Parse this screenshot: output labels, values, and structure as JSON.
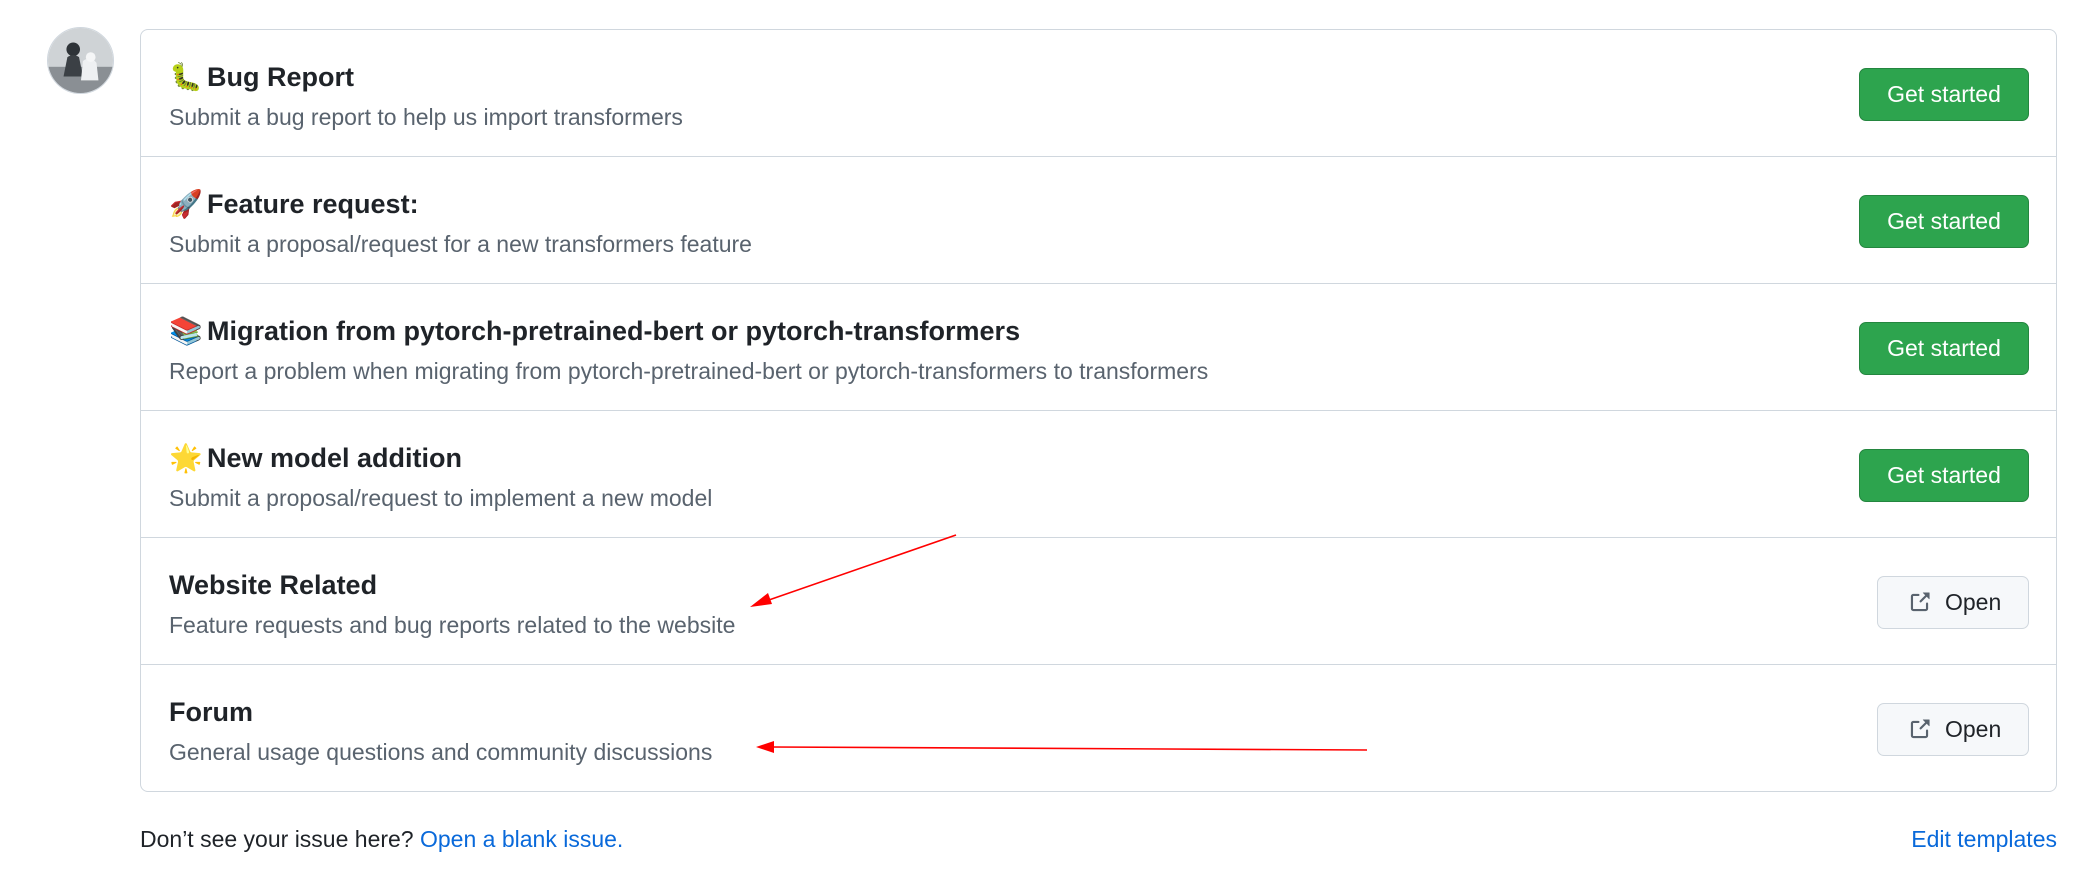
{
  "templates": [
    {
      "emoji": "🐛",
      "title": "Bug Report",
      "description": "Submit a bug report to help us import transformers",
      "action": "Get started"
    },
    {
      "emoji": "🚀",
      "title": "Feature request:",
      "description": "Submit a proposal/request for a new transformers feature",
      "action": "Get started"
    },
    {
      "emoji": "📚",
      "title": "Migration from pytorch-pretrained-bert or pytorch-transformers",
      "description": "Report a problem when migrating from pytorch-pretrained-bert or pytorch-transformers to transformers",
      "action": "Get started"
    },
    {
      "emoji": "🌟",
      "title": "New model addition",
      "description": "Submit a proposal/request to implement a new model",
      "action": "Get started"
    }
  ],
  "links": [
    {
      "title": "Website Related",
      "description": "Feature requests and bug reports related to the website",
      "action": "Open"
    },
    {
      "title": "Forum",
      "description": "General usage questions and community discussions",
      "action": "Open"
    }
  ],
  "footer": {
    "prompt": "Don’t see your issue here?",
    "blank_issue_link": "Open a blank issue.",
    "edit_templates_link": "Edit templates"
  },
  "colors": {
    "primary_button": "#2da44e",
    "link": "#0969da",
    "annotation_arrow": "#ff0000"
  }
}
